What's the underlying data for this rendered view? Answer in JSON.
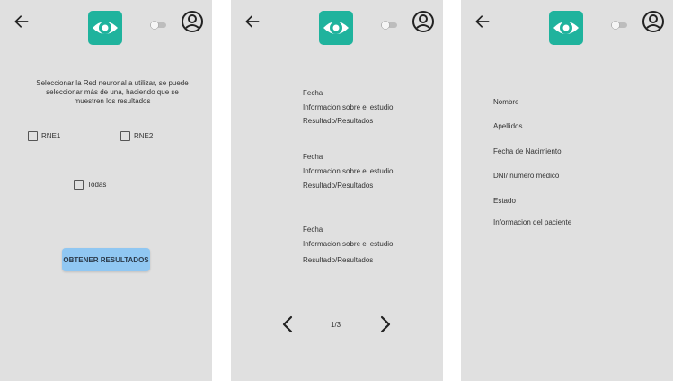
{
  "icons": {
    "back": "arrow-left-icon",
    "logo": "eye-logo-icon",
    "toggle": "toggle-switch-icon",
    "account": "account-circle-icon",
    "prev": "chevron-left-icon",
    "next": "chevron-right-icon"
  },
  "colors": {
    "screen_bg": "#e0e0e0",
    "logo_bg": "#1fb39d",
    "button_bg": "#90c7f2"
  },
  "screen1": {
    "description": "Seleccionar la Red neuronal a utilizar, se puede seleccionar más de una, haciendo que se muestren los resultados",
    "options": [
      {
        "label": "RNE1",
        "checked": false
      },
      {
        "label": "RNE2",
        "checked": false
      },
      {
        "label": "Todas",
        "checked": false
      }
    ],
    "button_label": "OBTENER RESULTADOS"
  },
  "screen2": {
    "results": [
      {
        "date": "Fecha",
        "info": "Informacion sobre el estudio",
        "result": "Resultado/Resultados"
      },
      {
        "date": "Fecha",
        "info": "Informacion sobre el estudio",
        "result": "Resultado/Resultados"
      },
      {
        "date": "Fecha",
        "info": "Informacion sobre el estudio",
        "result": "Resultado/Resultados"
      }
    ],
    "page_indicator": "1/3"
  },
  "screen3": {
    "fields": [
      "Nombre",
      "Apellidos",
      "Fecha de Nacimiento",
      "DNI/ numero medico",
      "Estado",
      "Informacion del paciente"
    ]
  }
}
